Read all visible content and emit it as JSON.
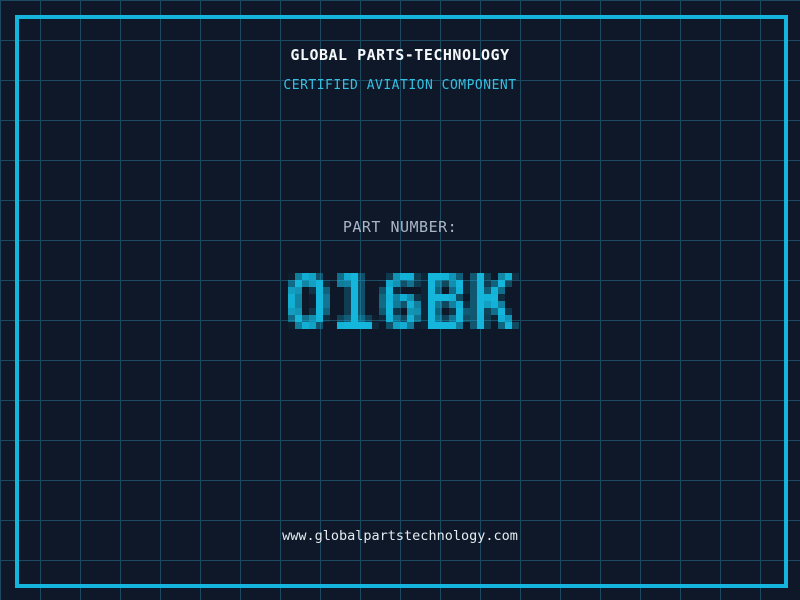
{
  "header": {
    "company_name": "GLOBAL PARTS-TECHNOLOGY",
    "subtitle": "CERTIFIED AVIATION COMPONENT"
  },
  "part": {
    "label": "PART NUMBER:",
    "number": "O16BK"
  },
  "footer": {
    "website": "www.globalpartstechnology.com"
  },
  "colors": {
    "background": "#0f1828",
    "grid_line": "#1d4a63",
    "frame_border": "#14b4dc",
    "title_text": "#f5f8fa",
    "subtitle_text": "#35bfe2",
    "part_label_text": "#a9b6c6",
    "part_number_text": "#14b6dc",
    "footer_text": "#e4ecf2"
  }
}
